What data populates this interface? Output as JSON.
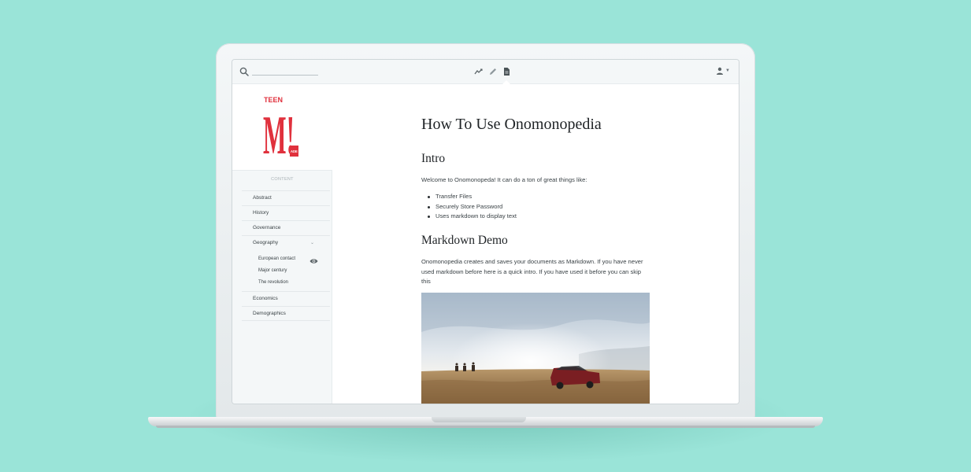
{
  "colors": {
    "background": "#9ae4d8",
    "brand": "#e0313d",
    "text": "#3a4246"
  },
  "toolbar": {
    "search_icon": "search-icon",
    "search_placeholder": "",
    "tools": [
      "chart-icon",
      "pencil-icon",
      "document-icon"
    ],
    "active_tool": "document-icon",
    "user_icon": "user-icon"
  },
  "logo": {
    "top_text": "TEEN",
    "main_text": "M!",
    "side_text": "ADE"
  },
  "sidebar": {
    "section_title": "CONTENT",
    "items": [
      {
        "label": "Abstract"
      },
      {
        "label": "History"
      },
      {
        "label": "Governance"
      },
      {
        "label": "Geography",
        "expanded": true,
        "children": [
          {
            "label": "European contact",
            "viewing": true
          },
          {
            "label": "Major century"
          },
          {
            "label": "The revolution"
          }
        ]
      },
      {
        "label": "Economics"
      },
      {
        "label": "Demographics"
      }
    ]
  },
  "document": {
    "title": "How To Use Onomonopedia",
    "intro_heading": "Intro",
    "intro_text": "Welcome to Onomonopeda! It can do a ton of great things like:",
    "bullets": [
      "Transfer Files",
      "Securely Store Password",
      "Uses markdown to display text"
    ],
    "demo_heading": "Markdown Demo",
    "demo_text": "Onomonopedia creates and saves your documents as Markdown. If you have never used markdown before here is a quick intro. If you have used it before you can skip this"
  }
}
